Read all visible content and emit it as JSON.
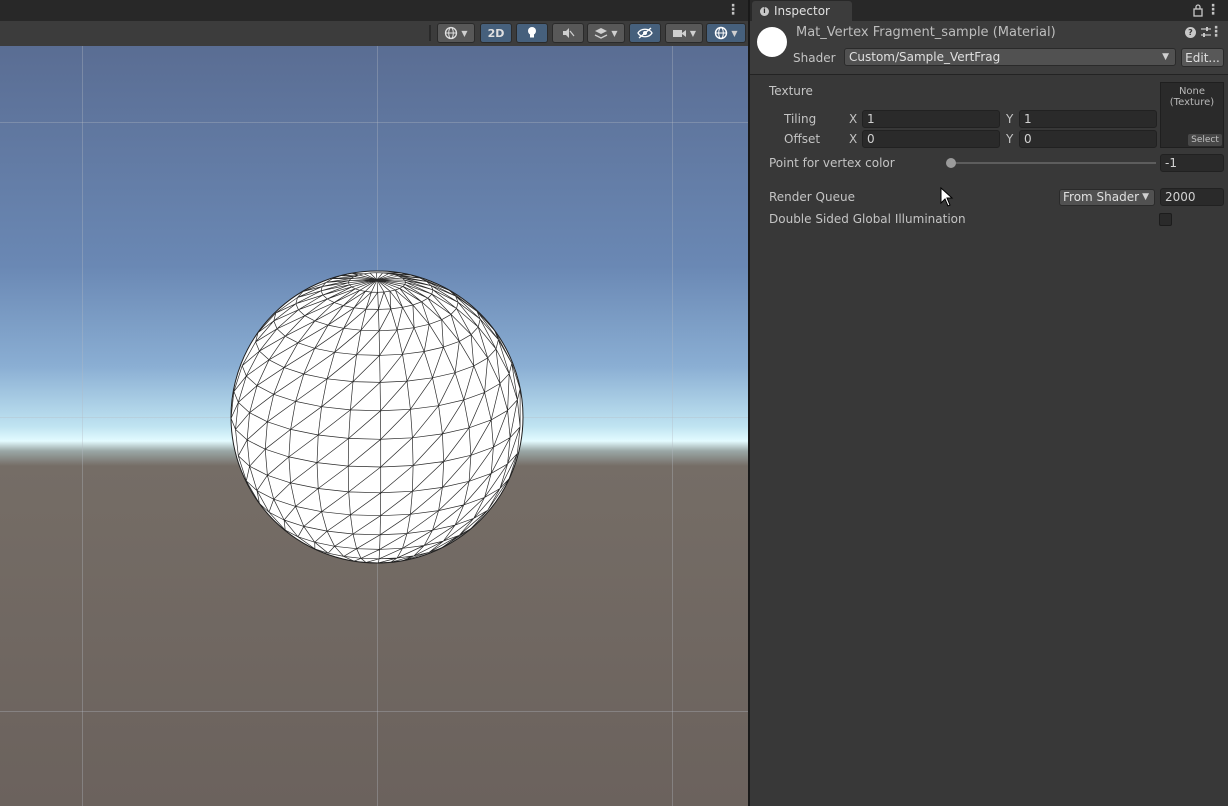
{
  "scene": {
    "menu_glyph": "⋮",
    "toolbar": {
      "btn_2d_label": "2D",
      "colors": {
        "active": "#46607c",
        "inactive": "#585858"
      }
    },
    "sky_colors": [
      "#5a6d93",
      "#8aaed3",
      "#e3fbff",
      "#6b625d"
    ]
  },
  "inspector": {
    "tab_label": "Inspector",
    "tab_info_glyph": "i",
    "menu_glyph": "⋮",
    "material": {
      "title": "Mat_Vertex Fragment_sample (Material)",
      "preview_color": "#ffffff",
      "help_glyph": "?",
      "menu_glyph": "⋮",
      "shader_label": "Shader",
      "shader_value": "Custom/Sample_VertFrag",
      "edit_label": "Edit..."
    },
    "properties": {
      "texture_label": "Texture",
      "texture_slot_text": "None (Texture)",
      "texture_select_label": "Select",
      "tiling_label": "Tiling",
      "tiling_x_label": "X",
      "tiling_x": "1",
      "tiling_y_label": "Y",
      "tiling_y": "1",
      "offset_label": "Offset",
      "offset_x_label": "X",
      "offset_x": "0",
      "offset_y_label": "Y",
      "offset_y": "0",
      "point_label": "Point for vertex color",
      "point_value": "-1",
      "point_slider_fraction": 0.0,
      "render_queue_label": "Render Queue",
      "render_queue_mode": "From Shader",
      "render_queue_value": "2000",
      "dsgi_label": "Double Sided Global Illumination",
      "dsgi_checked": false
    }
  }
}
